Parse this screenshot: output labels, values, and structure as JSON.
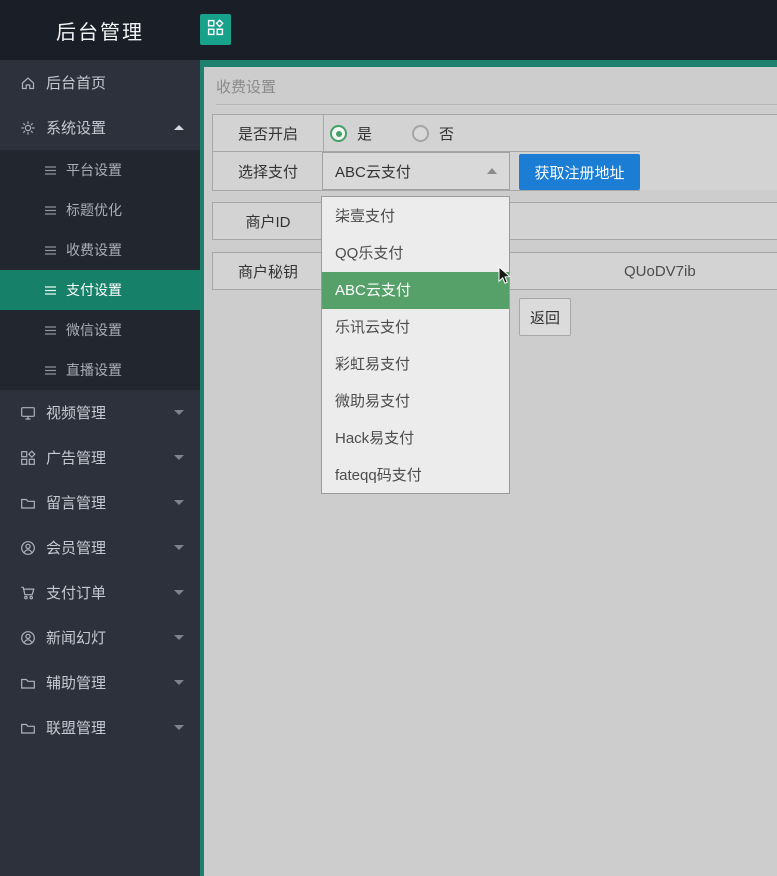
{
  "header": {
    "title": "后台管理"
  },
  "sidebar": {
    "items": [
      {
        "label": "后台首页",
        "icon": "home-icon"
      },
      {
        "label": "系统设置",
        "icon": "gear-icon",
        "expanded": true,
        "children": [
          {
            "label": "平台设置"
          },
          {
            "label": "标题优化"
          },
          {
            "label": "收费设置"
          },
          {
            "label": "支付设置",
            "active": true
          },
          {
            "label": "微信设置"
          },
          {
            "label": "直播设置"
          }
        ]
      },
      {
        "label": "视频管理",
        "icon": "monitor-icon"
      },
      {
        "label": "广告管理",
        "icon": "grid-diamond-icon"
      },
      {
        "label": "留言管理",
        "icon": "folder-icon"
      },
      {
        "label": "会员管理",
        "icon": "user-circle-icon"
      },
      {
        "label": "支付订单",
        "icon": "cart-icon"
      },
      {
        "label": "新闻幻灯",
        "icon": "user-circle-icon"
      },
      {
        "label": "辅助管理",
        "icon": "folder-icon"
      },
      {
        "label": "联盟管理",
        "icon": "folder-icon"
      }
    ]
  },
  "content": {
    "panel_title": "收费设置",
    "form": {
      "enable_label": "是否开启",
      "enable_yes": "是",
      "enable_no": "否",
      "enable_selected": "是",
      "payment_label": "选择支付",
      "payment_selected": "ABC云支付",
      "register_button": "获取注册地址",
      "merchant_id_label": "商户ID",
      "merchant_id_value": "",
      "merchant_key_label": "商户秘钥",
      "merchant_key_visible_value": "QUoDV7ib",
      "back_button": "返回"
    },
    "payment_dropdown": {
      "options": [
        "柒壹支付",
        "QQ乐支付",
        "ABC云支付",
        "乐讯云支付",
        "彩虹易支付",
        "微助易支付",
        "Hack易支付",
        "fateqq码支付"
      ],
      "selected": "ABC云支付",
      "selected_index": 2
    }
  },
  "colors": {
    "accent_teal": "#1E8170",
    "header_button_teal": "#18A28B",
    "active_menu_teal": "#178069",
    "primary_blue": "#1B7DD3",
    "dropdown_selected_green": "#55A169",
    "radio_selected_green": "#44A266"
  }
}
